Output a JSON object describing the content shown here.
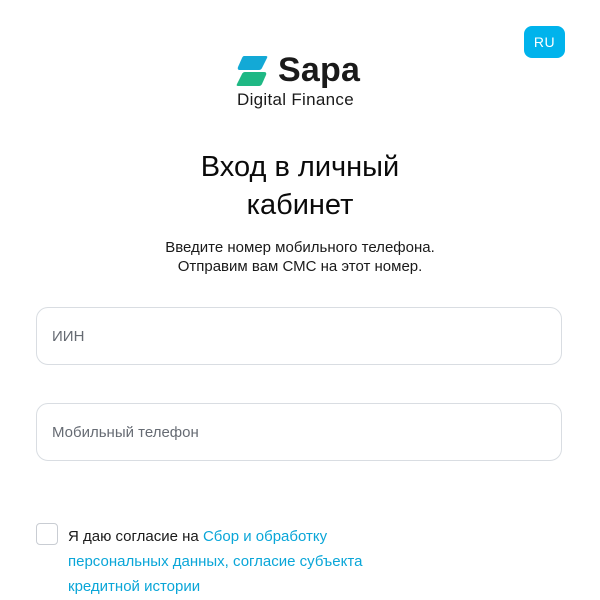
{
  "language": {
    "current": "RU"
  },
  "brand": {
    "name": "Sapa",
    "tagline": "Digital Finance",
    "colors": {
      "accent": "#00b3ec",
      "logo_blue": "#13a9d6",
      "logo_green": "#1fb884"
    }
  },
  "login": {
    "title_line1": "Вход в личный",
    "title_line2": "кабинет",
    "subtitle_line1": "Введите номер мобильного телефона.",
    "subtitle_line2": "Отправим вам СМС на этот номер."
  },
  "form": {
    "iin": {
      "placeholder": "ИИН",
      "value": ""
    },
    "phone": {
      "placeholder": "Мобильный телефон",
      "value": ""
    }
  },
  "consent": {
    "checked": false,
    "text_prefix": "Я даю согласие на ",
    "link_text": "Сбор и обработку персональных данных, согласие субъекта кредитной истории"
  }
}
